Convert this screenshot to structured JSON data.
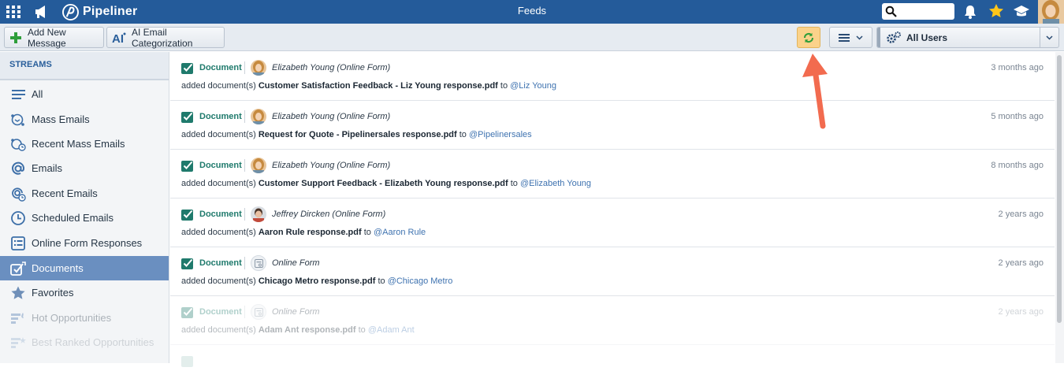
{
  "topbar": {
    "app_name": "Pipeliner",
    "page_title": "Feeds",
    "search_placeholder": "",
    "brand_color": "#245b9a"
  },
  "toolbar": {
    "add_message_label": "Add New Message",
    "ai_label": "AI Email Categorization",
    "users_filter": "All Users"
  },
  "sidebar": {
    "heading": "STREAMS",
    "items": [
      {
        "label": "All",
        "icon": "list-icon"
      },
      {
        "label": "Mass Emails",
        "icon": "mass-email-icon"
      },
      {
        "label": "Recent Mass Emails",
        "icon": "recent-mass-email-icon"
      },
      {
        "label": "Emails",
        "icon": "at-icon"
      },
      {
        "label": "Recent Emails",
        "icon": "recent-email-icon"
      },
      {
        "label": "Scheduled Emails",
        "icon": "clock-icon"
      },
      {
        "label": "Online Form Responses",
        "icon": "form-icon"
      },
      {
        "label": "Documents",
        "icon": "document-icon",
        "active": true
      },
      {
        "label": "Favorites",
        "icon": "star-icon"
      },
      {
        "label": "Hot Opportunities",
        "icon": "hot-opportunity-icon"
      },
      {
        "label": "Best Ranked Opportunities",
        "icon": "ranked-opportunity-icon"
      }
    ]
  },
  "feed": [
    {
      "type": "Document",
      "author": "Elizabeth Young (Online Form)",
      "time": "3 months ago",
      "action": "added document(s)",
      "document": "Customer Satisfaction Feedback - Liz Young response.pdf",
      "to": "to",
      "mention": "@Liz Young"
    },
    {
      "type": "Document",
      "author": "Elizabeth Young (Online Form)",
      "time": "5 months ago",
      "action": "added document(s)",
      "document": "Request for Quote - Pipelinersales response.pdf",
      "to": "to",
      "mention": "@Pipelinersales"
    },
    {
      "type": "Document",
      "author": "Elizabeth Young (Online Form)",
      "time": "8 months ago",
      "action": "added document(s)",
      "document": "Customer Support Feedback - Elizabeth Young response.pdf",
      "to": "to",
      "mention": "@Elizabeth Young"
    },
    {
      "type": "Document",
      "author": "Jeffrey Dircken (Online Form)",
      "time": "2 years ago",
      "action": "added document(s)",
      "document": "Aaron Rule response.pdf",
      "to": "to",
      "mention": "@Aaron Rule"
    },
    {
      "type": "Document",
      "author": "Online Form",
      "time": "2 years ago",
      "action": "added document(s)",
      "document": "Chicago Metro response.pdf",
      "to": "to",
      "mention": "@Chicago Metro"
    },
    {
      "type": "Document",
      "author": "Online Form",
      "time": "2 years ago",
      "action": "added document(s)",
      "document": "Adam Ant response.pdf",
      "to": "to",
      "mention": "@Adam Ant"
    }
  ],
  "colors": {
    "accent": "#245b9a",
    "refresh_highlight": "#fbd28a",
    "callout_arrow": "#f26b4f",
    "document_green": "#1f7a6c"
  }
}
